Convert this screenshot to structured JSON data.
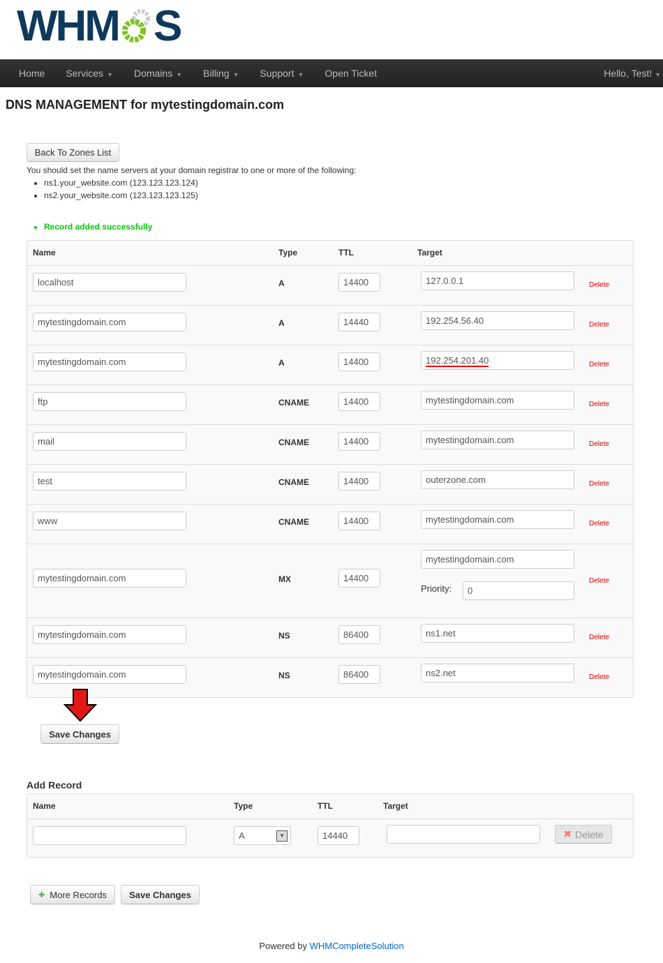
{
  "logo": "WHMCS",
  "nav": {
    "items": [
      {
        "label": "Home",
        "dd": false
      },
      {
        "label": "Services",
        "dd": true
      },
      {
        "label": "Domains",
        "dd": true
      },
      {
        "label": "Billing",
        "dd": true
      },
      {
        "label": "Support",
        "dd": true
      },
      {
        "label": "Open Ticket",
        "dd": false
      }
    ],
    "user": "Hello, Test!"
  },
  "title": "DNS MANAGEMENT for mytestingdomain.com",
  "back_button": "Back To Zones List",
  "ns_note": "You should set the name servers at your domain registrar to one or more of the following:",
  "nameservers": [
    "ns1.your_website.com (123.123.123.124)",
    "ns2.your_website.com (123.123.123.125)"
  ],
  "success_message": "Record added successfully",
  "columns": {
    "name": "Name",
    "type": "Type",
    "ttl": "TTL",
    "target": "Target"
  },
  "delete_label": "Delete",
  "priority_label": "Priority:",
  "records": [
    {
      "name": "localhost",
      "type": "A",
      "ttl": "14400",
      "target": "127.0.0.1"
    },
    {
      "name": "mytestingdomain.com",
      "type": "A",
      "ttl": "14440",
      "target": "192.254.56.40"
    },
    {
      "name": "mytestingdomain.com",
      "type": "A",
      "ttl": "14400",
      "target": "192.254.201.40",
      "highlight": true
    },
    {
      "name": "ftp",
      "type": "CNAME",
      "ttl": "14400",
      "target": "mytestingdomain.com"
    },
    {
      "name": "mail",
      "type": "CNAME",
      "ttl": "14400",
      "target": "mytestingdomain.com"
    },
    {
      "name": "test",
      "type": "CNAME",
      "ttl": "14400",
      "target": "outerzone.com"
    },
    {
      "name": "www",
      "type": "CNAME",
      "ttl": "14400",
      "target": "mytestingdomain.com"
    },
    {
      "name": "mytestingdomain.com",
      "type": "MX",
      "ttl": "14400",
      "target": "mytestingdomain.com",
      "priority": "0"
    },
    {
      "name": "mytestingdomain.com",
      "type": "NS",
      "ttl": "86400",
      "target": "ns1.net"
    },
    {
      "name": "mytestingdomain.com",
      "type": "NS",
      "ttl": "86400",
      "target": "ns2.net"
    }
  ],
  "save_changes": "Save Changes",
  "add_record": {
    "title": "Add Record",
    "name": "",
    "type": "A",
    "ttl": "14440",
    "target": "",
    "delete": "Delete"
  },
  "more_records": "More Records",
  "footer": {
    "prefix": "Powered by",
    "link": "WHMCompleteSolution"
  },
  "colors": {
    "nav": "#222222",
    "success": "#00cc00",
    "delete": "#cc0000",
    "logo": "#0d3a5c",
    "gear": "#7dc41f"
  }
}
